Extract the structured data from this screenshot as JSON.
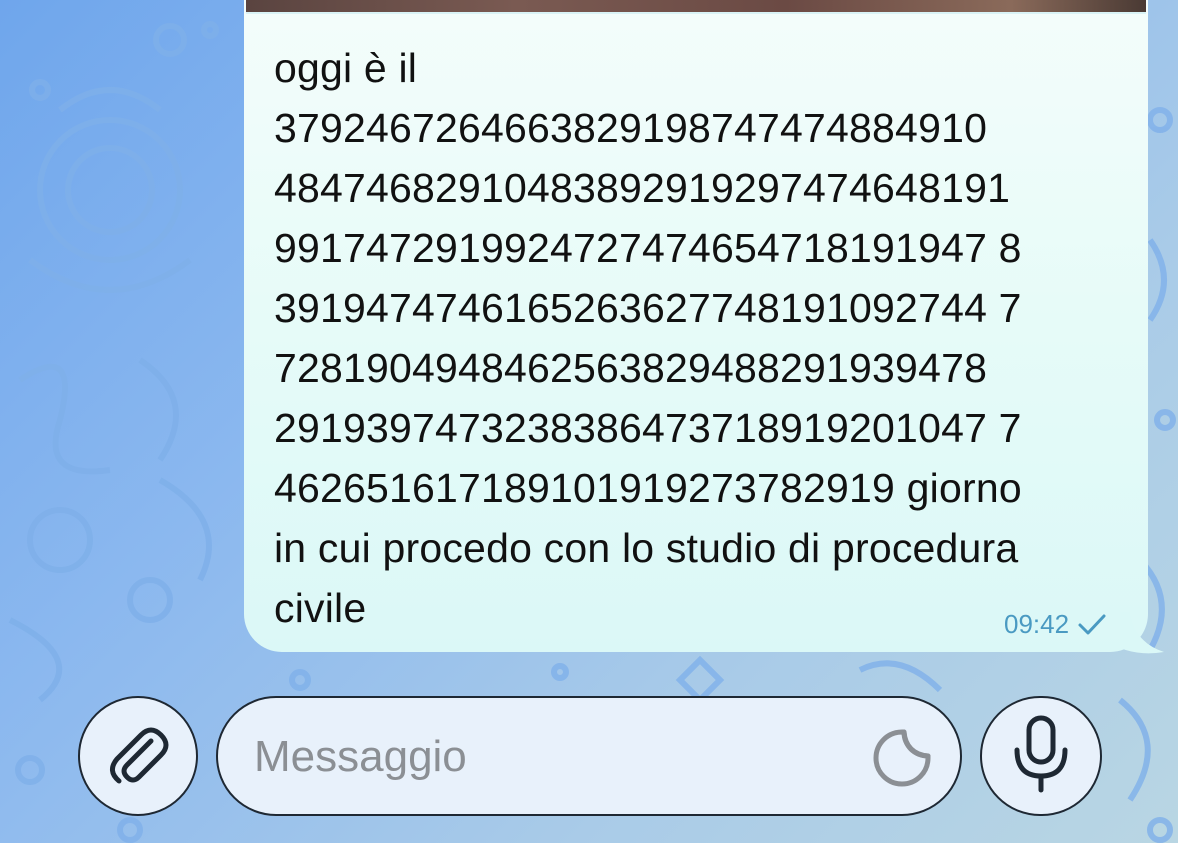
{
  "message": {
    "text": "oggi è il\n3792467264663829198747474884910\n48474682910483892919297474648191\n9917472919924727474654718191947 8\n3919474746165263627748191092744 7\n7281904948462563829488291939478\n2919397473238386473718919201047 7\n462651617189101919273782919 giorno\nin cui procedo con lo studio di procedura\ncivile",
    "time": "09:42",
    "status_icon": "single-check-icon"
  },
  "composer": {
    "placeholder": "Messaggio",
    "attach_icon": "paperclip-icon",
    "sticker_icon": "sticker-icon",
    "mic_icon": "microphone-icon"
  },
  "colors": {
    "bubble": "#e6fbf8",
    "meta": "#4a9ac2",
    "background": "#8bb8ef"
  }
}
